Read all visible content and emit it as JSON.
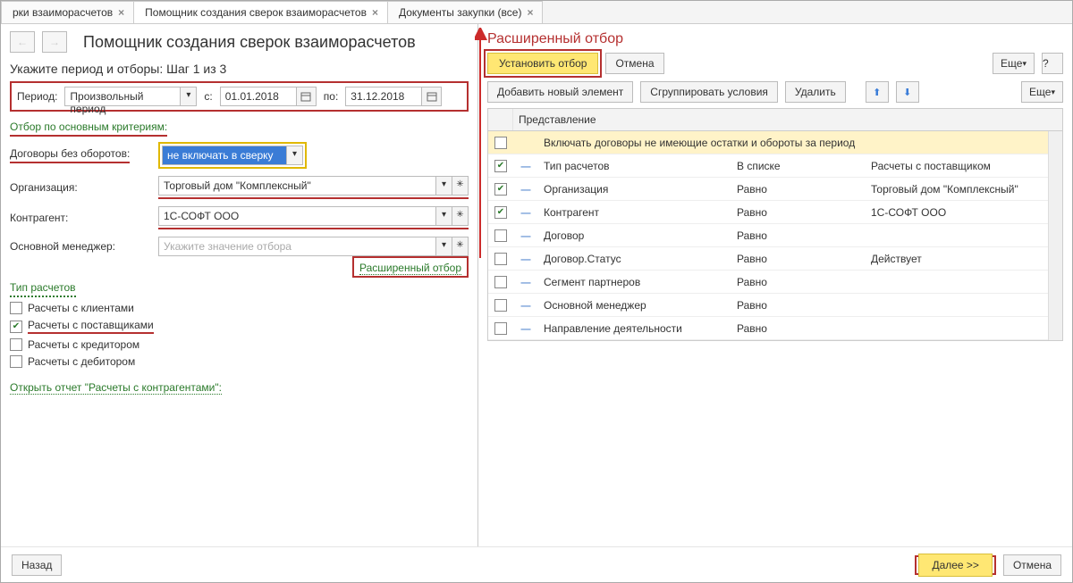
{
  "tabs": [
    {
      "label": "рки взаиморасчетов"
    },
    {
      "label": "Помощник создания сверок взаиморасчетов"
    },
    {
      "label": "Документы закупки (все)"
    }
  ],
  "left": {
    "title": "Помощник создания сверок взаиморасчетов",
    "step_line": "Укажите период и отборы:  Шаг 1 из 3",
    "period": {
      "label": "Период:",
      "type_value": "Произвольный период",
      "from_label": "с:",
      "from_value": "01.01.2018",
      "to_label": "по:",
      "to_value": "31.12.2018"
    },
    "criteria_header": "Отбор по основным критериям:",
    "contracts_no_turnover": {
      "label": "Договоры без оборотов:",
      "value": "не включать в сверку"
    },
    "org": {
      "label": "Организация:",
      "value": "Торговый дом \"Комплексный\""
    },
    "counterparty": {
      "label": "Контрагент:",
      "value": "1С-СОФТ ООО"
    },
    "manager": {
      "label": "Основной менеджер:",
      "placeholder": "Укажите значение отбора"
    },
    "adv_filter_link": "Расширенный отбор",
    "types_header": "Тип расчетов",
    "types": [
      {
        "label": "Расчеты с клиентами",
        "checked": false,
        "mark": false
      },
      {
        "label": "Расчеты с поставщиками",
        "checked": true,
        "mark": true
      },
      {
        "label": "Расчеты с кредитором",
        "checked": false,
        "mark": false
      },
      {
        "label": "Расчеты с дебитором",
        "checked": false,
        "mark": false
      }
    ],
    "report_link": "Открыть отчет \"Расчеты с контрагентами\":"
  },
  "right": {
    "title": "Расширенный отбор",
    "toolbar1": {
      "apply": "Установить отбор",
      "cancel": "Отмена",
      "more": "Еще",
      "help": "?"
    },
    "toolbar2": {
      "add": "Добавить новый элемент",
      "group": "Сгруппировать условия",
      "delete": "Удалить",
      "more": "Еще"
    },
    "grid": {
      "header": "Представление",
      "header_full": "Включать договоры не имеющие остатки и обороты за период",
      "rows": [
        {
          "checked": true,
          "name": "Тип расчетов",
          "cond": "В списке",
          "val": "Расчеты с поставщиком"
        },
        {
          "checked": true,
          "name": "Организация",
          "cond": "Равно",
          "val": "Торговый дом \"Комплексный\""
        },
        {
          "checked": true,
          "name": "Контрагент",
          "cond": "Равно",
          "val": "1С-СОФТ ООО"
        },
        {
          "checked": false,
          "name": "Договор",
          "cond": "Равно",
          "val": ""
        },
        {
          "checked": false,
          "name": "Договор.Статус",
          "cond": "Равно",
          "val": "Действует"
        },
        {
          "checked": false,
          "name": "Сегмент партнеров",
          "cond": "Равно",
          "val": ""
        },
        {
          "checked": false,
          "name": "Основной менеджер",
          "cond": "Равно",
          "val": ""
        },
        {
          "checked": false,
          "name": "Направление деятельности",
          "cond": "Равно",
          "val": ""
        }
      ]
    }
  },
  "bottom": {
    "back": "Назад",
    "next": "Далее >>",
    "cancel": "Отмена"
  }
}
